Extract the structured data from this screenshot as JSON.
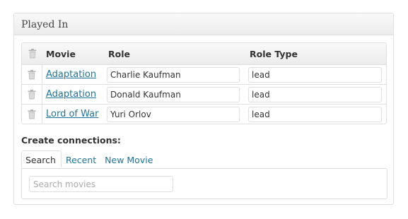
{
  "box": {
    "title": "Played In"
  },
  "table": {
    "headers": {
      "movie": "Movie",
      "role": "Role",
      "role_type": "Role Type"
    },
    "rows": [
      {
        "movie": "Adaptation",
        "role": "Charlie Kaufman",
        "role_type": "lead"
      },
      {
        "movie": "Adaptation",
        "role": "Donald Kaufman",
        "role_type": "lead"
      },
      {
        "movie": "Lord of War",
        "role": "Yuri Orlov",
        "role_type": "lead"
      }
    ]
  },
  "create": {
    "title": "Create connections:",
    "tabs": [
      "Search",
      "Recent",
      "New Movie"
    ],
    "active_tab": "Search",
    "search_placeholder": "Search movies",
    "search_value": ""
  },
  "icons": {
    "delete": "trash-icon"
  },
  "colors": {
    "link": "#21759b",
    "border": "#dfdfdf"
  }
}
